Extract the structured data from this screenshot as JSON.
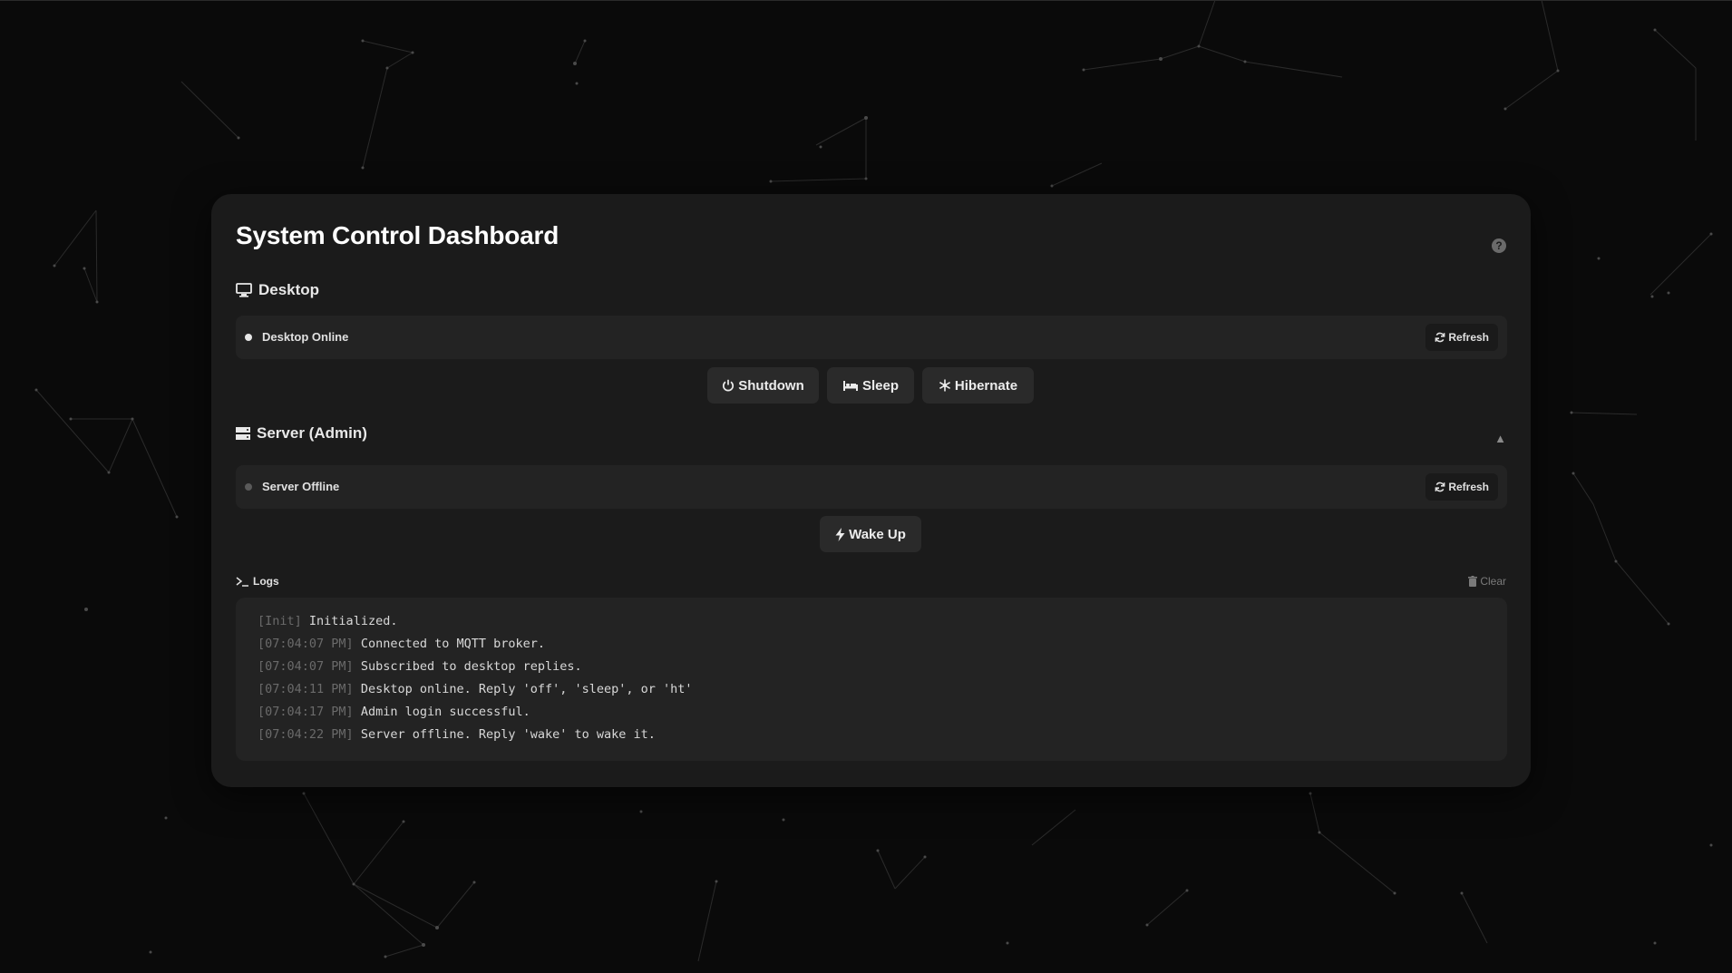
{
  "app": {
    "title": "System Control Dashboard",
    "help_icon": "question-circle-icon"
  },
  "desktop": {
    "heading": "Desktop",
    "icon": "monitor-icon",
    "status": {
      "text": "Desktop Online",
      "dot_color": "#e6e6e6",
      "refresh_label": "Refresh"
    },
    "actions": {
      "shutdown": "Shutdown",
      "sleep": "Sleep",
      "hibernate": "Hibernate"
    }
  },
  "server": {
    "heading": "Server (Admin)",
    "icon": "server-icon",
    "collapse_symbol": "▲",
    "status": {
      "text": "Server Offline",
      "dot_color": "#5a5a5a",
      "refresh_label": "Refresh"
    },
    "actions": {
      "wake": "Wake Up"
    }
  },
  "logs": {
    "heading": "Logs",
    "clear_label": "Clear",
    "entries": [
      {
        "time": "[Init]",
        "message": "Initialized."
      },
      {
        "time": "[07:04:07 PM]",
        "message": "Connected to MQTT broker."
      },
      {
        "time": "[07:04:07 PM]",
        "message": "Subscribed to desktop replies."
      },
      {
        "time": "[07:04:11 PM]",
        "message": "Desktop online. Reply 'off', 'sleep', or 'ht'"
      },
      {
        "time": "[07:04:17 PM]",
        "message": "Admin login successful."
      },
      {
        "time": "[07:04:22 PM]",
        "message": "Server offline. Reply 'wake' to wake it."
      }
    ]
  },
  "colors": {
    "background": "#0a0a0a",
    "panel": "#1b1b1b",
    "surface": "#232323",
    "button": "#2a2a2a",
    "text_muted": "#6a6a6a"
  }
}
